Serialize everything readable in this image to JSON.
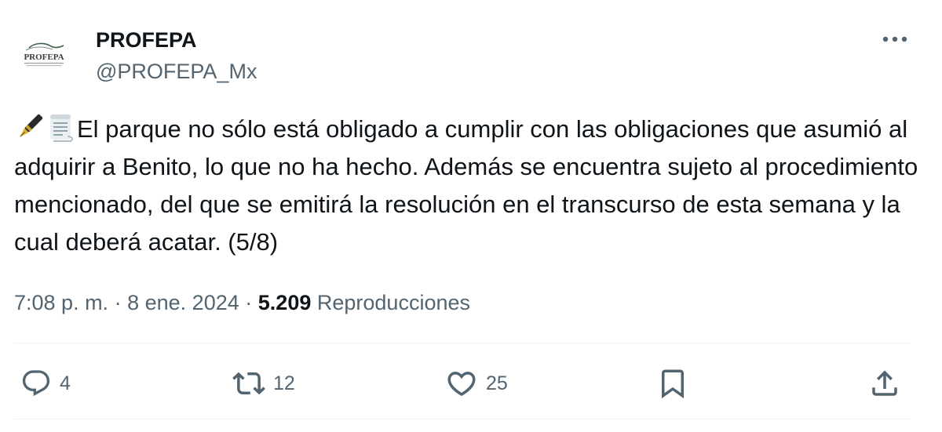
{
  "author": {
    "display_name": "PROFEPA",
    "handle": "@PROFEPA_Mx",
    "avatar_text": "PROFEPA",
    "avatar_icon": "profepa-logo"
  },
  "tweet": {
    "emojis": [
      "pen-emoji",
      "scroll-emoji"
    ],
    "text": "El parque no sólo está obligado a cumplir con las obligaciones que asumió al adquirir a Benito, lo que no ha hecho. Además se encuentra sujeto al procedimiento mencionado, del que se emitirá la resolución en el transcurso de esta semana y la cual deberá acatar. (5/8)",
    "time": "7:08 p. m.",
    "separator": "·",
    "date": "8 ene. 2024",
    "views_count": "5.209",
    "views_label": "Reproducciones"
  },
  "actions": {
    "replies": "4",
    "reposts": "12",
    "likes": "25"
  },
  "colors": {
    "text": "#0f1419",
    "secondary": "#536471",
    "divider": "#eff3f4"
  }
}
